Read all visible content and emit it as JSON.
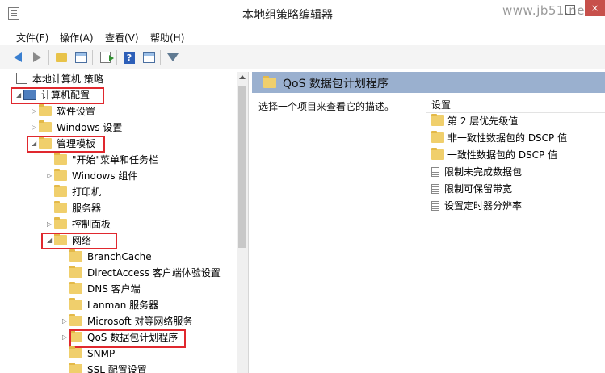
{
  "window": {
    "title": "本地组策略编辑器",
    "watermark": "www.jb51.net",
    "close_glyph": "×"
  },
  "menu": [
    {
      "label": "文件(F)"
    },
    {
      "label": "操作(A)"
    },
    {
      "label": "查看(V)"
    },
    {
      "label": "帮助(H)"
    }
  ],
  "toolbar": {
    "icons": [
      "back-arrow-icon",
      "forward-arrow-icon",
      "up-folder-icon",
      "show-hide-tree-icon",
      "export-list-icon",
      "help-icon",
      "properties-icon",
      "filter-icon"
    ],
    "help_glyph": "?"
  },
  "tree": {
    "root": "本地计算机 策略",
    "computer_config": "计算机配置",
    "software_settings": "软件设置",
    "windows_settings": "Windows 设置",
    "admin_templates": "管理模板",
    "start_menu": "\"开始\"菜单和任务栏",
    "windows_components": "Windows 组件",
    "printers": "打印机",
    "server": "服务器",
    "control_panel": "控制面板",
    "network": "网络",
    "branchcache": "BranchCache",
    "directaccess": "DirectAccess 客户端体验设置",
    "dns_client": "DNS 客户端",
    "lanman_server": "Lanman 服务器",
    "ms_p2p": "Microsoft 对等网络服务",
    "qos": "QoS 数据包计划程序",
    "snmp": "SNMP",
    "ssl": "SSL 配置设置",
    "expanded_glyph": "◢",
    "collapsed_glyph": "▷"
  },
  "details": {
    "title": "QoS 数据包计划程序",
    "description": "选择一个项目来查看它的描述。",
    "column_header": "设置",
    "items": [
      {
        "label": "第 2 层优先级值",
        "icon": "folder"
      },
      {
        "label": "非一致性数据包的 DSCP 值",
        "icon": "folder"
      },
      {
        "label": "一致性数据包的 DSCP 值",
        "icon": "folder"
      },
      {
        "label": "限制未完成数据包",
        "icon": "policy-setting"
      },
      {
        "label": "限制可保留带宽",
        "icon": "policy-setting"
      },
      {
        "label": "设置定时器分辨率",
        "icon": "policy-setting"
      }
    ]
  },
  "colors": {
    "header_bar": "#9ab0cf",
    "highlight": "#e0282e",
    "folder": "#f0cf6c"
  }
}
